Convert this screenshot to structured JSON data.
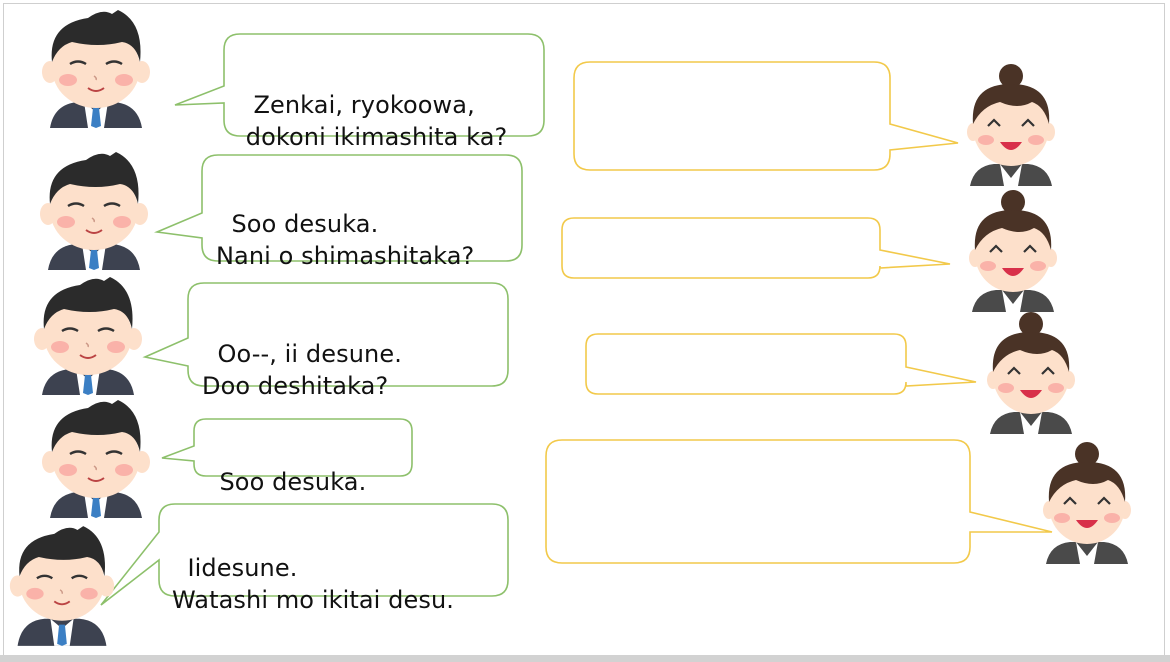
{
  "conversation": {
    "man_lines": [
      {
        "line1": "Zenkai, ryokoowa,",
        "line2": " dokoni ikimashita ka?"
      },
      {
        "line1": "Soo desuka.",
        "line2": "Nani o shimashitaka?"
      },
      {
        "line1": "Oo--, ii desune.",
        "line2": "Doo deshitaka?"
      },
      {
        "line1": "Soo desuka.",
        "line2": ""
      },
      {
        "line1": "Iidesune.",
        "line2": "Watashi mo ikitai desu."
      }
    ],
    "woman_lines": [
      "",
      "",
      "",
      ""
    ]
  },
  "colors": {
    "man_bubble_border": "#8dc06b",
    "woman_bubble_border": "#f2c94a",
    "skin": "#fde0cb",
    "cheek": "#f9a6a0",
    "hair": "#2b2b2b",
    "suit": "#3d4250",
    "tie": "#3b7fc4",
    "woman_hair": "#4a3326"
  }
}
